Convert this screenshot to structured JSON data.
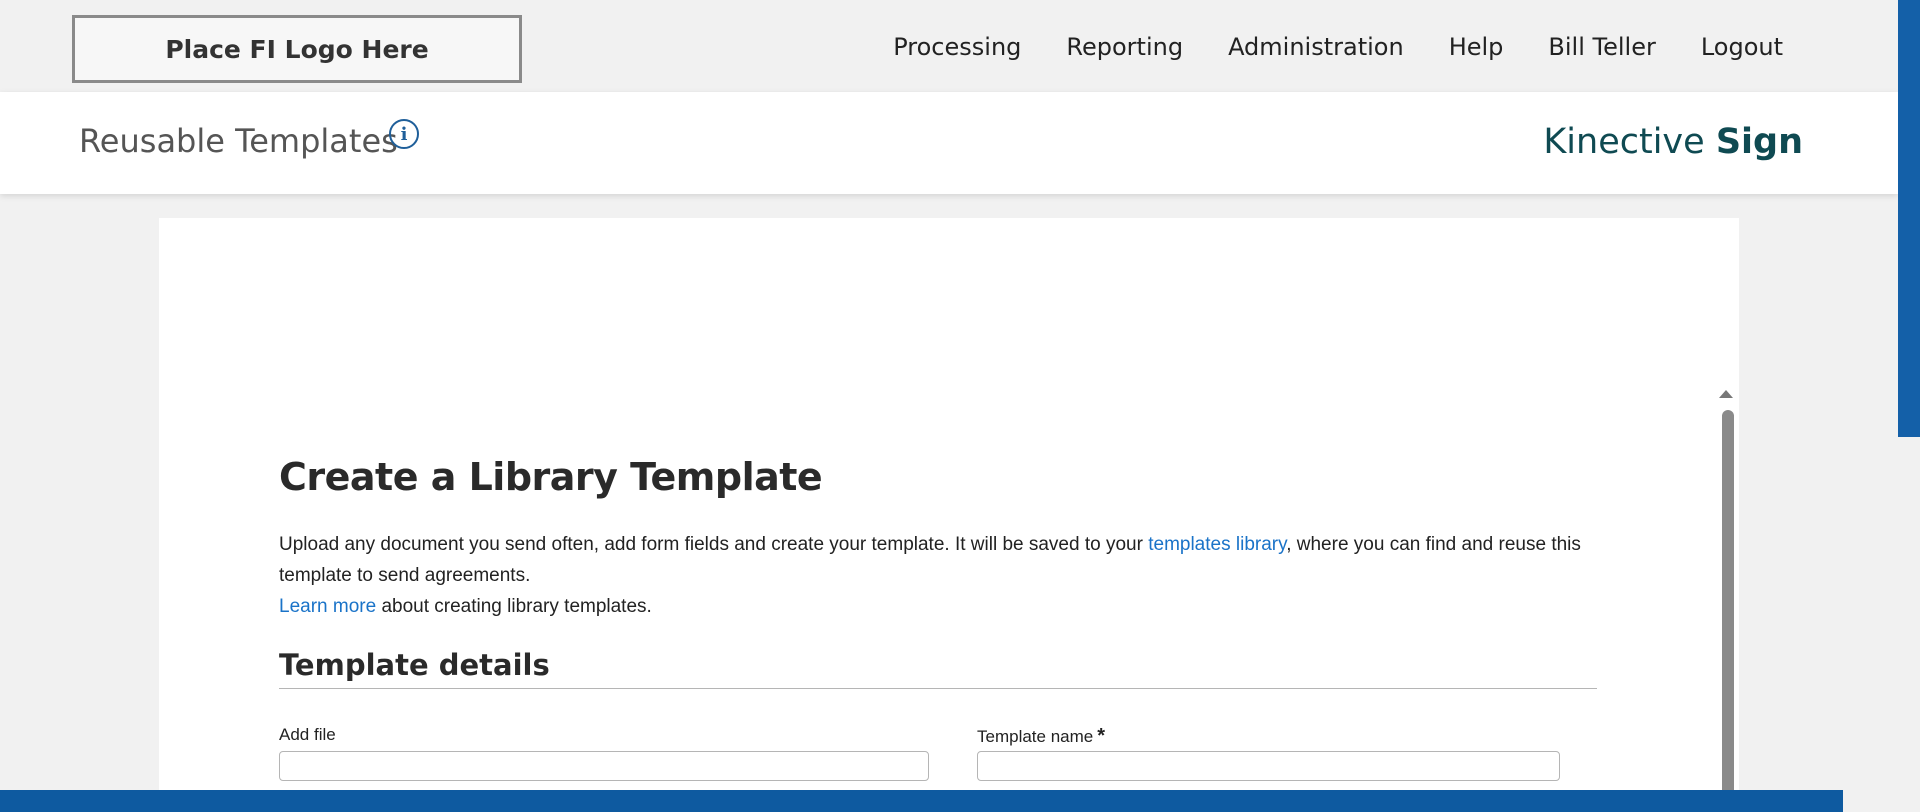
{
  "header": {
    "logo_text": "Place FI Logo Here",
    "nav": [
      "Processing",
      "Reporting",
      "Administration",
      "Help",
      "Bill Teller",
      "Logout"
    ]
  },
  "subheader": {
    "title": "Reusable Templates",
    "info_glyph": "i",
    "brand_light": "Kinective ",
    "brand_bold": "Sign"
  },
  "main": {
    "heading": "Create a Library Template",
    "desc_part1": "Upload any document you send often, add form fields and create your template. It will be saved to your ",
    "desc_link1": "templates library",
    "desc_part2": ", where you can find and reuse this template to send agreements.",
    "desc_link2": "Learn more",
    "desc_part3": " about creating library templates.",
    "section_title": "Template details",
    "add_file_label": "Add file",
    "template_name_label": "Template name",
    "required_mark": "*"
  },
  "colors": {
    "accent": "#1460a8",
    "link": "#1a73c8",
    "brand": "#0f4a52",
    "bottom_bar": "#0e5aa0"
  }
}
